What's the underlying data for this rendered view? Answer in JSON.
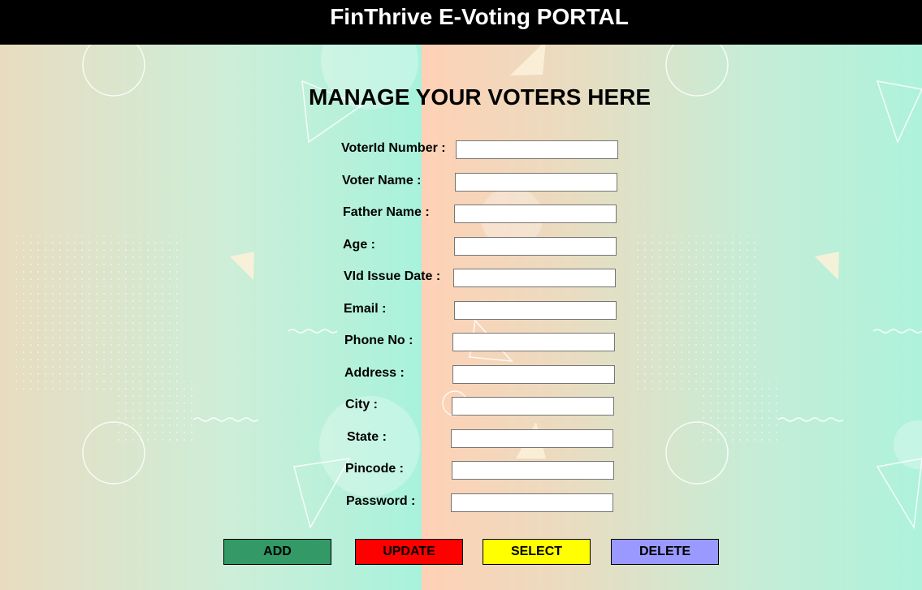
{
  "header": {
    "title": "FinThrive E-Voting PORTAL"
  },
  "form": {
    "title": "MANAGE YOUR VOTERS HERE",
    "fields": [
      {
        "label": "VoterId Number :",
        "value": ""
      },
      {
        "label": "Voter Name :",
        "value": ""
      },
      {
        "label": "Father Name :",
        "value": ""
      },
      {
        "label": "Age :",
        "value": ""
      },
      {
        "label": "VId Issue Date :",
        "value": ""
      },
      {
        "label": "Email :",
        "value": ""
      },
      {
        "label": "Phone No :",
        "value": ""
      },
      {
        "label": "Address :",
        "value": ""
      },
      {
        "label": "City :",
        "value": ""
      },
      {
        "label": "State :",
        "value": ""
      },
      {
        "label": "Pincode :",
        "value": ""
      },
      {
        "label": "Password :",
        "value": ""
      }
    ]
  },
  "buttons": {
    "add": {
      "label": "ADD",
      "color": "#339966"
    },
    "update": {
      "label": "UPDATE",
      "color": "#ff0000"
    },
    "select": {
      "label": "SELECT",
      "color": "#ffff00"
    },
    "delete": {
      "label": "DELETE",
      "color": "#9999ff"
    }
  },
  "colors": {
    "header_bg": "#000000",
    "background_mint": "#b2f0dc",
    "background_peach": "#ffd1b5",
    "background_beige": "#e8dcc0"
  }
}
